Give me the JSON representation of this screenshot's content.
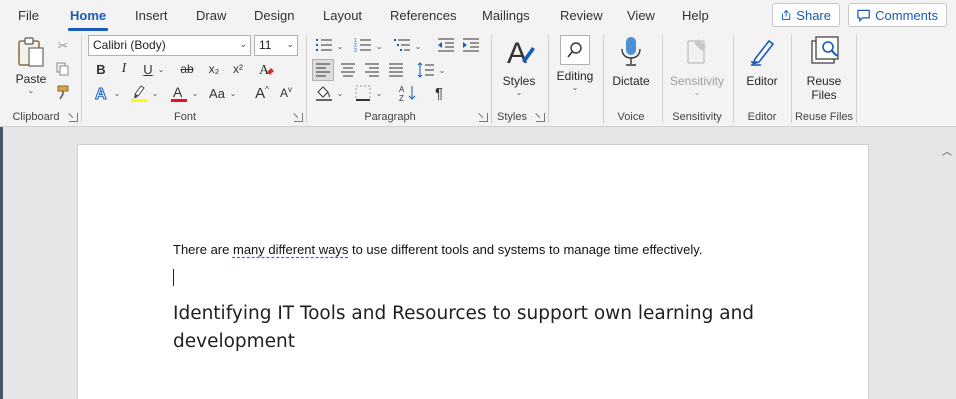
{
  "tabs": [
    "File",
    "Home",
    "Insert",
    "Draw",
    "Design",
    "Layout",
    "References",
    "Mailings",
    "Review",
    "View",
    "Help"
  ],
  "active_tab": "Home",
  "share_label": "Share",
  "comments_label": "Comments",
  "clipboard": {
    "paste_label": "Paste",
    "group_label": "Clipboard"
  },
  "font": {
    "font_name": "Calibri (Body)",
    "font_size": "11",
    "bold": "B",
    "italic": "I",
    "underline": "U",
    "strike": "ab",
    "subscript": "x₂",
    "superscript": "x²",
    "change_case": "Aa",
    "grow": "A",
    "shrink": "A",
    "group_label": "Font",
    "highlight_color": "#ffff00",
    "font_color": "#e81123"
  },
  "paragraph": {
    "group_label": "Paragraph"
  },
  "styles": {
    "label": "Styles",
    "group_label": "Styles"
  },
  "editing": {
    "label": "Editing"
  },
  "voice": {
    "dictate_label": "Dictate",
    "group_label": "Voice"
  },
  "sensitivity": {
    "label": "Sensitivity",
    "group_label": "Sensitivity"
  },
  "editor": {
    "label": "Editor",
    "group_label": "Editor"
  },
  "reuse": {
    "label_line1": "Reuse",
    "label_line2": "Files",
    "group_label": "Reuse Files"
  },
  "document": {
    "p1_before": "There are ",
    "p1_flagged": "many different ways",
    "p1_after": " to use different tools and systems to manage time effectively.",
    "heading": "Identifying IT Tools and Resources to support own learning and development"
  },
  "colors": {
    "accent": "#185abd",
    "ribbon_bg": "#f3f3f3",
    "canvas_bg": "#e6e6e6"
  }
}
